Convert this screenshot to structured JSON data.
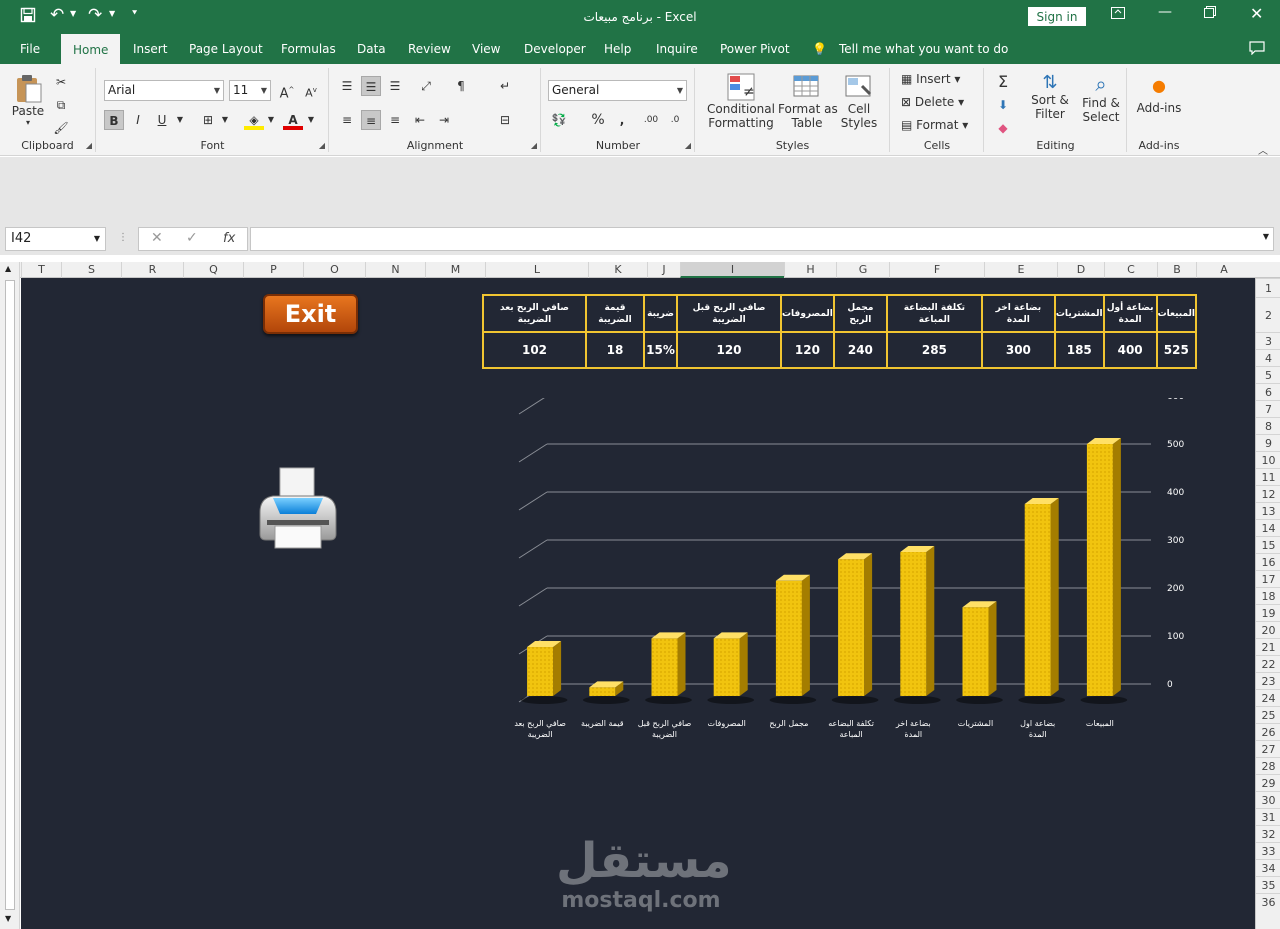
{
  "titlebar": {
    "title": "برنامج مبيعات  -  Excel",
    "sign_in": "Sign in"
  },
  "tabs": [
    "File",
    "Home",
    "Insert",
    "Page Layout",
    "Formulas",
    "Data",
    "Review",
    "View",
    "Developer",
    "Help",
    "Inquire",
    "Power Pivot"
  ],
  "tell_me": "Tell me what you want to do",
  "ribbon": {
    "clipboard": {
      "label": "Clipboard",
      "paste": "Paste"
    },
    "font": {
      "label": "Font",
      "name": "Arial",
      "size": "11"
    },
    "alignment": {
      "label": "Alignment"
    },
    "number": {
      "label": "Number",
      "format": "General"
    },
    "styles": {
      "label": "Styles",
      "conditional": "Conditional",
      "conditional2": "Formatting",
      "format_as": "Format as",
      "format_as2": "Table",
      "cell": "Cell",
      "cell2": "Styles"
    },
    "cells": {
      "label": "Cells",
      "insert": "Insert",
      "delete": "Delete",
      "format": "Format"
    },
    "editing": {
      "label": "Editing",
      "sort": "Sort &",
      "sort2": "Filter",
      "find": "Find &",
      "find2": "Select"
    },
    "addins": {
      "label": "Add-ins",
      "addins": "Add-ins"
    }
  },
  "formula_bar": {
    "name_box": "I42",
    "value": ""
  },
  "columns": [
    "T",
    "S",
    "R",
    "Q",
    "P",
    "O",
    "N",
    "M",
    "L",
    "K",
    "J",
    "I",
    "H",
    "G",
    "F",
    "E",
    "D",
    "C",
    "B",
    "A"
  ],
  "selected_column": "I",
  "rows": [
    "1",
    "2",
    "3",
    "4",
    "5",
    "6",
    "7",
    "8",
    "9",
    "10",
    "11",
    "12",
    "13",
    "14",
    "15",
    "16",
    "17",
    "18",
    "19",
    "20",
    "21",
    "22",
    "23",
    "24",
    "25",
    "26",
    "27",
    "28",
    "29",
    "30",
    "31",
    "32",
    "33",
    "34",
    "35",
    "36"
  ],
  "exit_button": "Exit",
  "table": {
    "headers": [
      "المبيعات",
      "بضاعة أول المدة",
      "المشتريات",
      "بضاعة اخر المدة",
      "تكلفة البضاعة المباعة",
      "مجمل الربح",
      "المصروفات",
      "صافي الربح قبل الضريبة",
      "ضريبة",
      "قيمة الضريبة",
      "صافي الربح بعد الضريبة"
    ],
    "values": [
      "525",
      "400",
      "185",
      "300",
      "285",
      "240",
      "120",
      "120",
      "15%",
      "18",
      "102"
    ]
  },
  "chart_data": {
    "type": "bar",
    "categories": [
      "المبيعات",
      "بضاعة اول المدة",
      "المشتريات",
      "بضاعة اخر المدة",
      "تكلفة البضاعه المباعة",
      "مجمل الربح",
      "المصروفات",
      "صافي الربح قبل الضريبة",
      "قيمة الضريبة",
      "صافي الربح بعد الضريبة"
    ],
    "values": [
      525,
      400,
      185,
      300,
      285,
      240,
      120,
      120,
      18,
      102
    ],
    "ylim": [
      0,
      600
    ],
    "yticks": [
      "0",
      "100",
      "200",
      "300",
      "400",
      "500",
      "600"
    ],
    "axis_side": "right",
    "bar_color": "#f1c40f",
    "grid": true,
    "title": "",
    "xlabel": "",
    "ylabel": ""
  },
  "watermark": {
    "arabic": "مستقل",
    "latin": "mostaql.com"
  }
}
